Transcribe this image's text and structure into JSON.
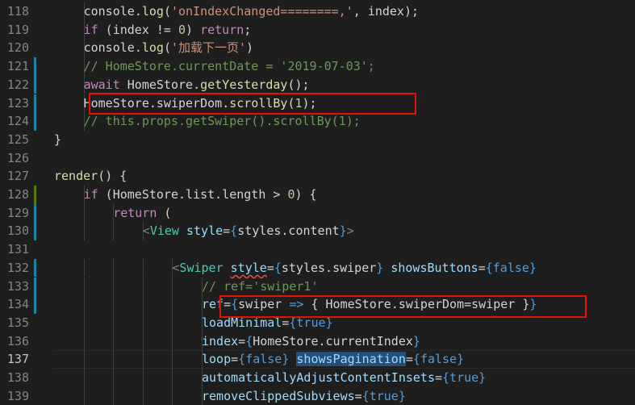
{
  "editor": {
    "lines": [
      {
        "number": "118",
        "mark": "",
        "indent": 2,
        "tokens": [
          {
            "t": "console",
            "c": "txt"
          },
          {
            "t": ".",
            "c": "txt"
          },
          {
            "t": "log",
            "c": "fn"
          },
          {
            "t": "(",
            "c": "txt"
          },
          {
            "t": "'onIndexChanged========,'",
            "c": "str"
          },
          {
            "t": ", ",
            "c": "txt"
          },
          {
            "t": "index",
            "c": "txt"
          },
          {
            "t": ");",
            "c": "txt"
          }
        ]
      },
      {
        "number": "119",
        "mark": "",
        "indent": 2,
        "tokens": [
          {
            "t": "if",
            "c": "kw"
          },
          {
            "t": " (",
            "c": "txt"
          },
          {
            "t": "index",
            "c": "txt"
          },
          {
            "t": " != ",
            "c": "txt"
          },
          {
            "t": "0",
            "c": "num"
          },
          {
            "t": ") ",
            "c": "txt"
          },
          {
            "t": "return",
            "c": "kw"
          },
          {
            "t": ";",
            "c": "txt"
          }
        ]
      },
      {
        "number": "120",
        "mark": "",
        "indent": 2,
        "tokens": [
          {
            "t": "console",
            "c": "txt"
          },
          {
            "t": ".",
            "c": "txt"
          },
          {
            "t": "log",
            "c": "fn"
          },
          {
            "t": "(",
            "c": "txt"
          },
          {
            "t": "'加载下一页'",
            "c": "str"
          },
          {
            "t": ")",
            "c": "txt"
          }
        ]
      },
      {
        "number": "121",
        "mark": "modified",
        "indent": 2,
        "tokens": [
          {
            "t": "// HomeStore.currentDate = '2019-07-03';",
            "c": "cmt"
          }
        ]
      },
      {
        "number": "122",
        "mark": "modified",
        "indent": 2,
        "tokens": [
          {
            "t": "await",
            "c": "kw"
          },
          {
            "t": " ",
            "c": "txt"
          },
          {
            "t": "HomeStore",
            "c": "txt"
          },
          {
            "t": ".",
            "c": "txt"
          },
          {
            "t": "getYesterday",
            "c": "fn"
          },
          {
            "t": "();",
            "c": "txt"
          }
        ]
      },
      {
        "number": "123",
        "mark": "modified",
        "indent": 2,
        "tokens": [
          {
            "t": "HomeStore",
            "c": "txt"
          },
          {
            "t": ".",
            "c": "txt"
          },
          {
            "t": "swiperDom",
            "c": "txt"
          },
          {
            "t": ".",
            "c": "txt"
          },
          {
            "t": "scrollBy",
            "c": "fn"
          },
          {
            "t": "(",
            "c": "txt"
          },
          {
            "t": "1",
            "c": "num"
          },
          {
            "t": ");",
            "c": "txt"
          }
        ]
      },
      {
        "number": "124",
        "mark": "modified",
        "indent": 2,
        "tokens": [
          {
            "t": "// this.props.getSwiper().scrollBy(1);",
            "c": "cmt"
          }
        ]
      },
      {
        "number": "125",
        "mark": "",
        "indent": 1,
        "tokens": [
          {
            "t": "}",
            "c": "txt"
          }
        ]
      },
      {
        "number": "126",
        "mark": "",
        "indent": 0,
        "tokens": []
      },
      {
        "number": "127",
        "mark": "",
        "indent": 1,
        "tokens": [
          {
            "t": "render",
            "c": "fn"
          },
          {
            "t": "() {",
            "c": "txt"
          }
        ]
      },
      {
        "number": "128",
        "mark": "added",
        "indent": 2,
        "tokens": [
          {
            "t": "if",
            "c": "kw"
          },
          {
            "t": " (",
            "c": "txt"
          },
          {
            "t": "HomeStore",
            "c": "txt"
          },
          {
            "t": ".",
            "c": "txt"
          },
          {
            "t": "list",
            "c": "txt"
          },
          {
            "t": ".",
            "c": "txt"
          },
          {
            "t": "length",
            "c": "txt"
          },
          {
            "t": " > ",
            "c": "txt"
          },
          {
            "t": "0",
            "c": "num"
          },
          {
            "t": ") {",
            "c": "txt"
          }
        ]
      },
      {
        "number": "129",
        "mark": "modified",
        "indent": 3,
        "tokens": [
          {
            "t": "return",
            "c": "kw"
          },
          {
            "t": " (",
            "c": "txt"
          }
        ]
      },
      {
        "number": "130",
        "mark": "modified",
        "indent": 4,
        "tokens": [
          {
            "t": "<",
            "c": "ang"
          },
          {
            "t": "View",
            "c": "tag"
          },
          {
            "t": " ",
            "c": "txt"
          },
          {
            "t": "style",
            "c": "attr"
          },
          {
            "t": "=",
            "c": "txt"
          },
          {
            "t": "{",
            "c": "bool"
          },
          {
            "t": "styles",
            "c": "txt"
          },
          {
            "t": ".",
            "c": "txt"
          },
          {
            "t": "content",
            "c": "txt"
          },
          {
            "t": "}",
            "c": "bool"
          },
          {
            "t": ">",
            "c": "ang"
          }
        ]
      },
      {
        "number": "131",
        "mark": "",
        "indent": 0,
        "tokens": []
      },
      {
        "number": "132",
        "mark": "modified",
        "indent": 5,
        "tokens": [
          {
            "t": "<",
            "c": "ang"
          },
          {
            "t": "Swiper",
            "c": "tag"
          },
          {
            "t": " ",
            "c": "txt"
          },
          {
            "t": "style",
            "c": "attr",
            "wavy": true
          },
          {
            "t": "=",
            "c": "txt"
          },
          {
            "t": "{",
            "c": "bool"
          },
          {
            "t": "styles",
            "c": "txt"
          },
          {
            "t": ".",
            "c": "txt"
          },
          {
            "t": "swiper",
            "c": "txt"
          },
          {
            "t": "}",
            "c": "bool"
          },
          {
            "t": " ",
            "c": "txt"
          },
          {
            "t": "showsButtons",
            "c": "attr"
          },
          {
            "t": "=",
            "c": "txt"
          },
          {
            "t": "{",
            "c": "bool"
          },
          {
            "t": "false",
            "c": "bool"
          },
          {
            "t": "}",
            "c": "bool"
          }
        ]
      },
      {
        "number": "133",
        "mark": "modified",
        "indent": 6,
        "tokens": [
          {
            "t": "// ref='swiper1'",
            "c": "cmt"
          }
        ]
      },
      {
        "number": "134",
        "mark": "modified",
        "indent": 6,
        "tokens": [
          {
            "t": "ref",
            "c": "attr"
          },
          {
            "t": "=",
            "c": "txt"
          },
          {
            "t": "{",
            "c": "bool"
          },
          {
            "t": "swiper",
            "c": "txt"
          },
          {
            "t": " ",
            "c": "txt"
          },
          {
            "t": "=>",
            "c": "bool"
          },
          {
            "t": " { ",
            "c": "txt"
          },
          {
            "t": "HomeStore",
            "c": "txt"
          },
          {
            "t": ".",
            "c": "txt"
          },
          {
            "t": "swiperDom",
            "c": "txt"
          },
          {
            "t": "=",
            "c": "txt"
          },
          {
            "t": "swiper",
            "c": "txt"
          },
          {
            "t": " }",
            "c": "txt"
          },
          {
            "t": "}",
            "c": "bool"
          }
        ]
      },
      {
        "number": "135",
        "mark": "",
        "indent": 6,
        "tokens": [
          {
            "t": "loadMinimal",
            "c": "attr"
          },
          {
            "t": "=",
            "c": "txt"
          },
          {
            "t": "{",
            "c": "bool"
          },
          {
            "t": "true",
            "c": "bool"
          },
          {
            "t": "}",
            "c": "bool"
          }
        ]
      },
      {
        "number": "136",
        "mark": "",
        "indent": 6,
        "tokens": [
          {
            "t": "index",
            "c": "attr"
          },
          {
            "t": "=",
            "c": "txt"
          },
          {
            "t": "{",
            "c": "bool"
          },
          {
            "t": "HomeStore",
            "c": "txt"
          },
          {
            "t": ".",
            "c": "txt"
          },
          {
            "t": "currentIndex",
            "c": "txt"
          },
          {
            "t": "}",
            "c": "bool"
          }
        ]
      },
      {
        "number": "137",
        "mark": "",
        "indent": 6,
        "current": true,
        "tokens": [
          {
            "t": "loop",
            "c": "attr"
          },
          {
            "t": "=",
            "c": "txt"
          },
          {
            "t": "{",
            "c": "bool"
          },
          {
            "t": "false",
            "c": "bool"
          },
          {
            "t": "}",
            "c": "bool"
          },
          {
            "t": " ",
            "c": "txt"
          },
          {
            "t": "showsPagination",
            "c": "attr",
            "hl": true
          },
          {
            "t": "=",
            "c": "txt"
          },
          {
            "t": "{",
            "c": "bool"
          },
          {
            "t": "false",
            "c": "bool"
          },
          {
            "t": "}",
            "c": "bool"
          }
        ]
      },
      {
        "number": "138",
        "mark": "",
        "indent": 6,
        "tokens": [
          {
            "t": "automaticallyAdjustContentInsets",
            "c": "attr"
          },
          {
            "t": "=",
            "c": "txt"
          },
          {
            "t": "{",
            "c": "bool"
          },
          {
            "t": "true",
            "c": "bool"
          },
          {
            "t": "}",
            "c": "bool"
          }
        ]
      },
      {
        "number": "139",
        "mark": "",
        "indent": 6,
        "tokens": [
          {
            "t": "removeClippedSubviews",
            "c": "attr"
          },
          {
            "t": "=",
            "c": "txt"
          },
          {
            "t": "{",
            "c": "bool"
          },
          {
            "t": "true",
            "c": "bool"
          },
          {
            "t": "}",
            "c": "bool"
          }
        ]
      }
    ],
    "colors": {
      "modified": "#1b81a8",
      "added": "#587c0c",
      "callout": "#e51400"
    }
  }
}
